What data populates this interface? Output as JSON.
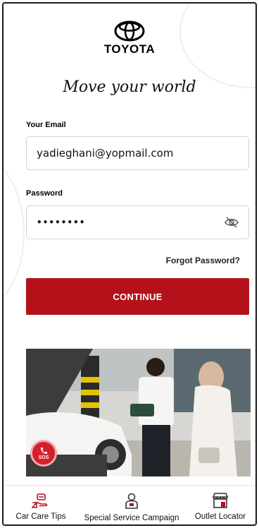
{
  "brand": {
    "name": "TOYOTA",
    "tagline": "Move your world"
  },
  "login": {
    "email_label": "Your Email",
    "email_value": "yadieghani@yopmail.com",
    "password_label": "Password",
    "password_masked": "••••••••",
    "forgot_label": "Forgot Password?",
    "continue_label": "CONTINUE"
  },
  "sos": {
    "label": "SOS"
  },
  "bottom_nav": [
    {
      "label": "Car Care Tips",
      "icon": "car-care-hand-icon"
    },
    {
      "label": "Special Service Campaign",
      "icon": "mechanic-icon"
    },
    {
      "label": "Outlet Locator",
      "icon": "store-icon"
    }
  ],
  "colors": {
    "primary": "#b4121b",
    "sos": "#d51f2b"
  }
}
